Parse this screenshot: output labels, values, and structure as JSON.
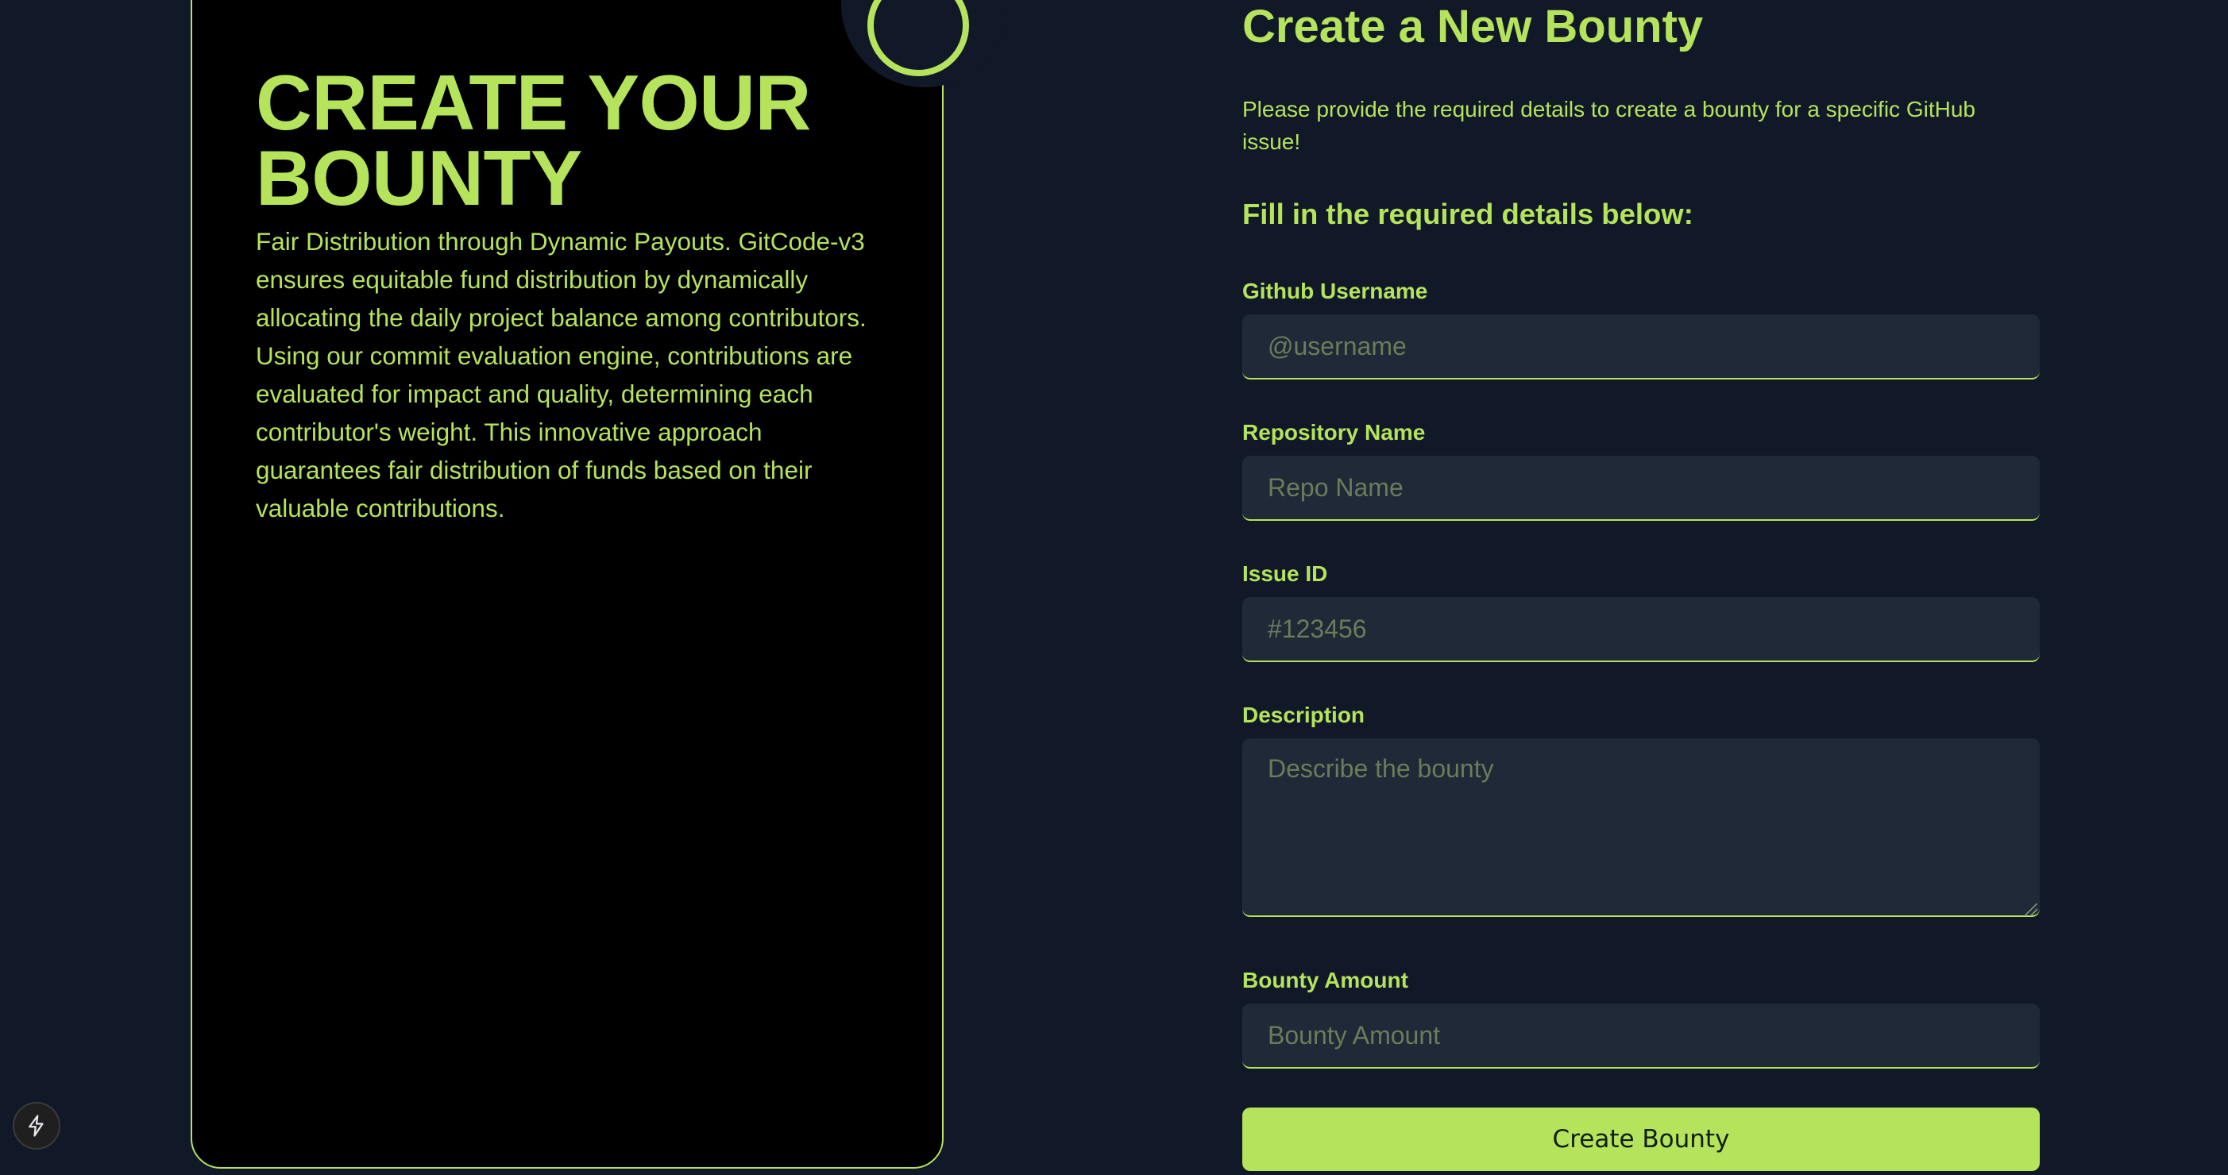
{
  "card": {
    "title": "CREATE YOUR BOUNTY",
    "text": "Fair Distribution through Dynamic Payouts. GitCode-v3 ensures equitable fund distribution by dynamically allocating the daily project balance among contributors. Using our commit evaluation engine, contributions are evaluated for impact and quality, determining each contributor's weight. This innovative approach guarantees fair distribution of funds based on their valuable contributions."
  },
  "form": {
    "title": "Create a New Bounty",
    "description": "Please provide the required details to create a bounty for a specific GitHub issue!",
    "subtitle": "Fill in the required details below:",
    "fields": [
      {
        "label": "Github Username",
        "placeholder": "@username"
      },
      {
        "label": "Repository Name",
        "placeholder": "Repo Name"
      },
      {
        "label": "Issue ID",
        "placeholder": "#123456"
      },
      {
        "label": "Description",
        "placeholder": "Describe the bounty"
      },
      {
        "label": "Bounty Amount",
        "placeholder": "Bounty Amount"
      }
    ],
    "submit_label": "Create Bounty"
  },
  "badge": {
    "icon": "lightning-bolt-icon"
  },
  "colors": {
    "accent": "#b5e35c",
    "background": "#111827",
    "card": "#000000",
    "input": "#1f2937"
  }
}
